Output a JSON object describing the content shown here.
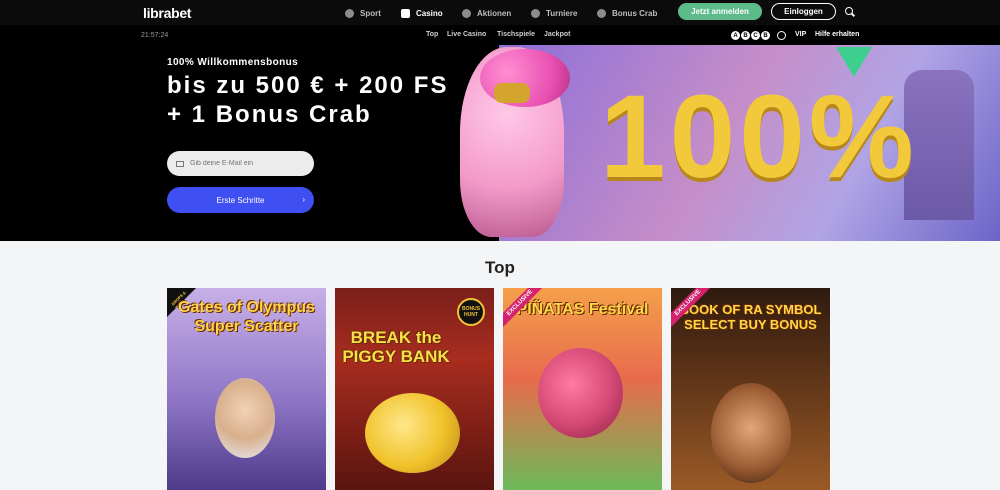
{
  "header": {
    "logo": "librabet",
    "nav": [
      {
        "label": "Sport",
        "icon": "soccer-ball-icon"
      },
      {
        "label": "Casino",
        "icon": "card-icon"
      },
      {
        "label": "Aktionen",
        "icon": "gift-icon"
      },
      {
        "label": "Turniere",
        "icon": "trophy-icon"
      },
      {
        "label": "Bonus Crab",
        "icon": "crab-icon"
      }
    ],
    "register_label": "Jetzt anmelden",
    "login_label": "Einloggen",
    "colors": {
      "register": "#5dbb8b",
      "background": "#0b0b0b"
    }
  },
  "subheader": {
    "clock": "21:57:24",
    "subnav": [
      "Top",
      "Live Casino",
      "Tischspiele",
      "Jackpot"
    ],
    "lang_symbols": [
      "A",
      "B",
      "C",
      "B"
    ],
    "vip_label": "VIP",
    "help_label": "Hilfe erhalten"
  },
  "hero": {
    "eyebrow": "100% Willkommensbonus",
    "headline": "bis zu 500 € + 200 FS + 1 Bonus Crab",
    "email_placeholder": "Gib deine E-Mail ein",
    "cta_label": "Erste Schritte",
    "banner_text": "100%"
  },
  "section": {
    "title": "Top"
  },
  "games": [
    {
      "title": "Gates of Olympus Super Scatter",
      "badge": "DROPS & WINS"
    },
    {
      "title": "BREAK the PIGGY BANK",
      "badge": "BONUS HUNT"
    },
    {
      "title": "PIÑATAS Festival",
      "badge": "EXCLUSIVE"
    },
    {
      "title": "BOOK OF RA SYMBOL SELECT BUY BONUS",
      "badge": "EXCLUSIVE"
    }
  ]
}
